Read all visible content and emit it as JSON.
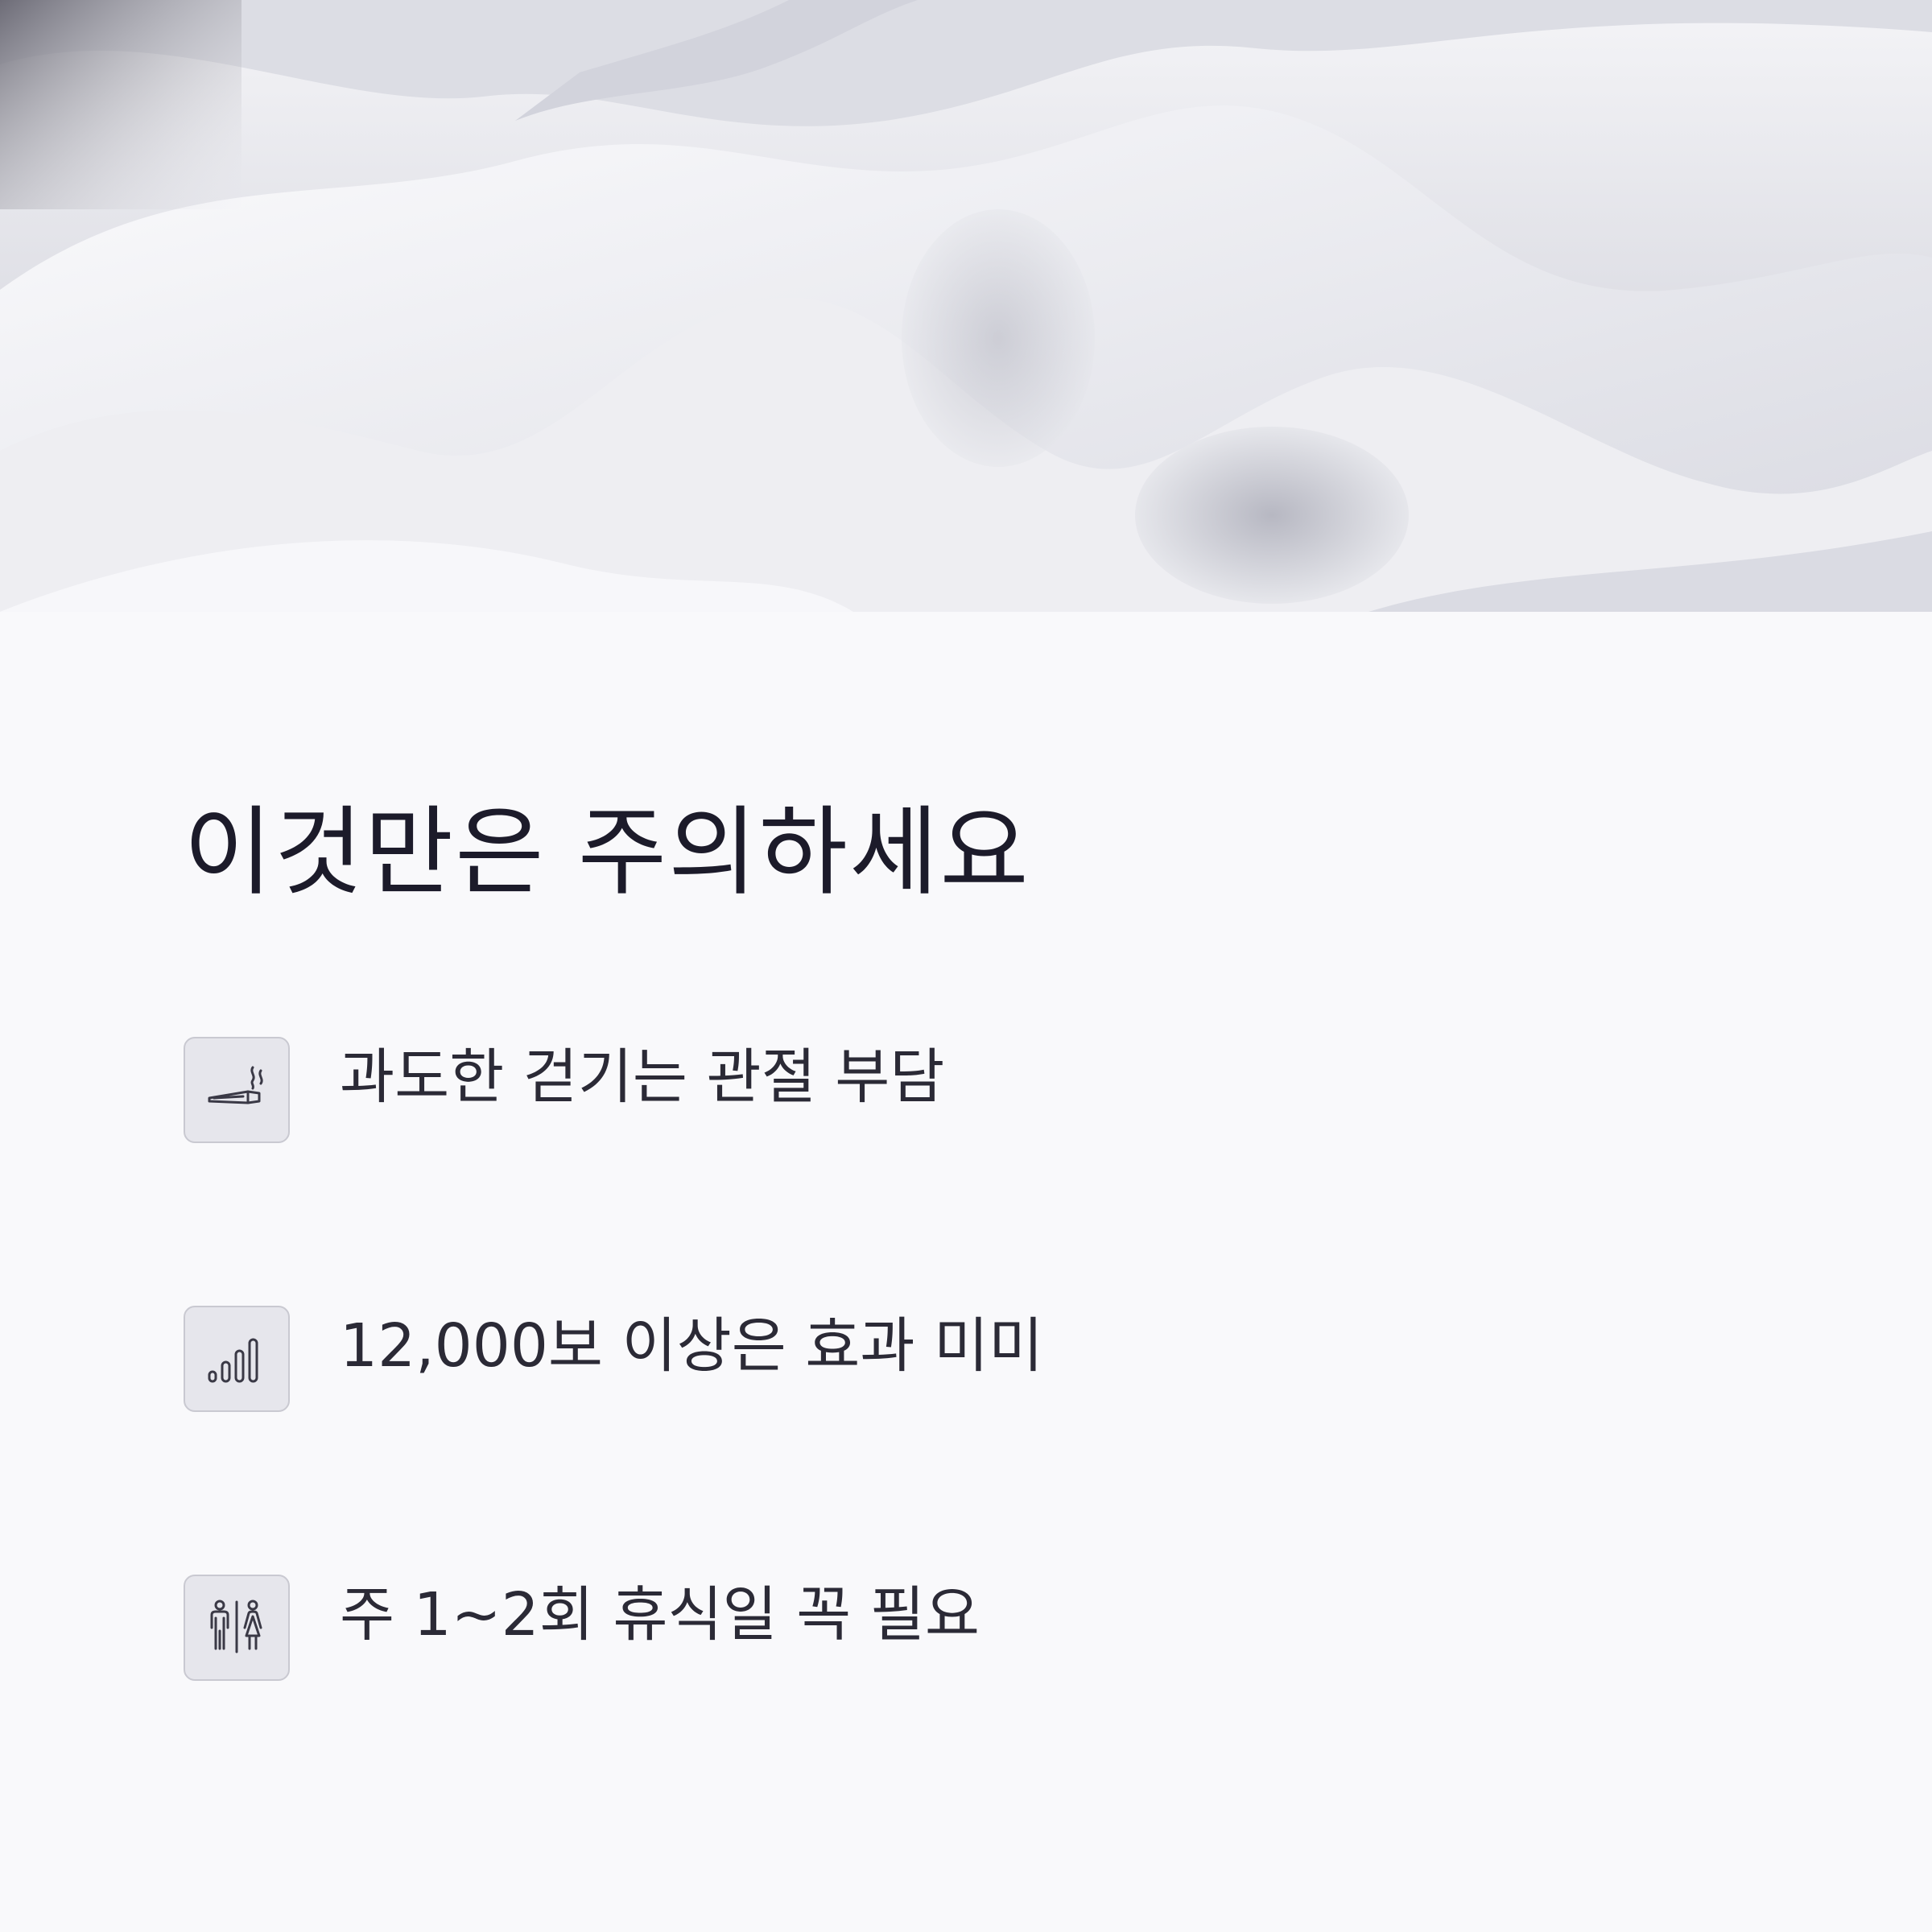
{
  "hero": {
    "image": "abstract-white-fabric-waves"
  },
  "section": {
    "title": "이것만은 주의하세요",
    "items": [
      {
        "icon": "cigarette-icon",
        "text": "과도한 걷기는 관절 부담"
      },
      {
        "icon": "signal-bars-icon",
        "text": "12,000보 이상은 효과 미미"
      },
      {
        "icon": "man-woman-icon",
        "text": "주 1~2회 휴식일 꼭 필요"
      }
    ]
  },
  "colors": {
    "background": "#f9f9fb",
    "title": "#1c1b2a",
    "text": "#2b2a36",
    "icon_box": "#e6e6ec"
  }
}
